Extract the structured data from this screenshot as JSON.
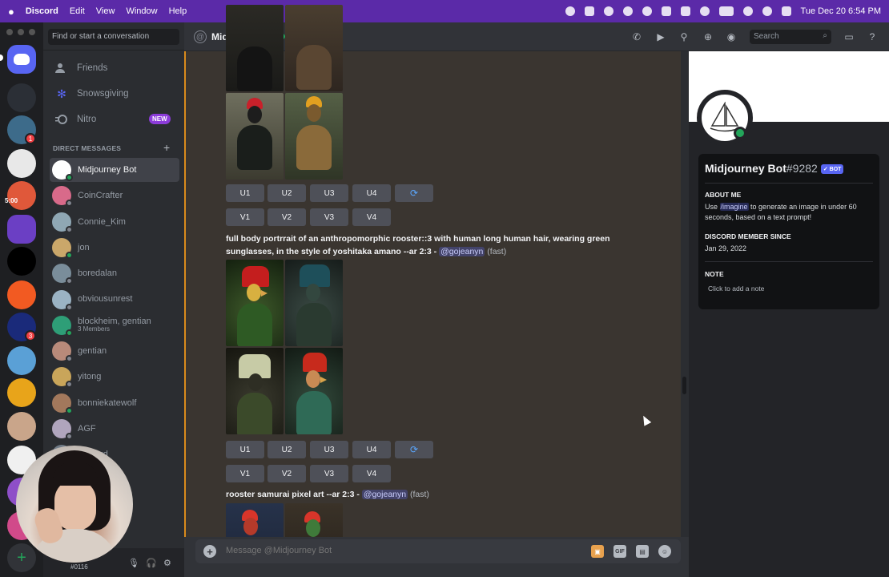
{
  "menubar": {
    "app": "Discord",
    "items": [
      "Edit",
      "View",
      "Window",
      "Help"
    ],
    "clock": "Tue Dec 20  6:54 PM"
  },
  "rail": {
    "server_text": "5:00",
    "badges": [
      "1",
      "3"
    ]
  },
  "sidebar": {
    "search_placeholder": "Find or start a conversation",
    "nav": [
      {
        "label": "Friends"
      },
      {
        "label": "Snowsgiving"
      },
      {
        "label": "Nitro",
        "badge": "NEW"
      }
    ],
    "dm_header": "DIRECT MESSAGES",
    "dms": [
      {
        "name": "Midjourney Bot",
        "active": true,
        "color": "#ffffff"
      },
      {
        "name": "CoinCrafter",
        "color": "#d86a8a"
      },
      {
        "name": "Connie_Kim",
        "color": "#8fa7b4"
      },
      {
        "name": "jon",
        "color": "#caa76a"
      },
      {
        "name": "boredalan",
        "color": "#7a8d9a"
      },
      {
        "name": "obviousunrest",
        "color": "#9bb3c4"
      },
      {
        "name": "blockheim, gentian",
        "sub": "3 Members",
        "color": "#2e9e77"
      },
      {
        "name": "gentian",
        "color": "#b88a7a"
      },
      {
        "name": "yitong",
        "color": "#c9a55a"
      },
      {
        "name": "bonniekatewolf",
        "color": "#a2785c"
      },
      {
        "name": "AGF",
        "color": "#b0a5bd"
      },
      {
        "name": "Howard",
        "color": "#6f7a86"
      }
    ],
    "user_tag": "#0116"
  },
  "topbar": {
    "title": "Midjourney Bot",
    "search_placeholder": "Search"
  },
  "messages": {
    "button_rows": [
      [
        "U1",
        "U2",
        "U3",
        "U4"
      ],
      [
        "V1",
        "V2",
        "V3",
        "V4"
      ]
    ],
    "reroll_icon": "refresh-icon",
    "prompt1": {
      "line1": "full body portrrait of an anthropomorphic rooster::3 with human long human hair, wearing green",
      "line2": "sunglasses, in the style of yoshitaka amano --ar 2:3 - ",
      "mention": "@gojeanyn",
      "speed": "(fast)"
    },
    "prompt2": {
      "text": "rooster samurai pixel art --ar 2:3 - ",
      "mention": "@gojeanyn",
      "speed": "(fast)"
    }
  },
  "composer": {
    "placeholder": "Message @Midjourney Bot",
    "gif_label": "GIF"
  },
  "profile": {
    "name": "Midjourney Bot",
    "discriminator": "#9282",
    "bot_badge": "✓ BOT",
    "about_header": "ABOUT ME",
    "about_pre": "Use ",
    "about_cmd": "/imagine",
    "about_post": " to generate an image in under 60 seconds, based on a text prompt!",
    "member_since_header": "DISCORD MEMBER SINCE",
    "member_since": "Jan 29, 2022",
    "note_header": "NOTE",
    "note_placeholder": "Click to add a note"
  }
}
